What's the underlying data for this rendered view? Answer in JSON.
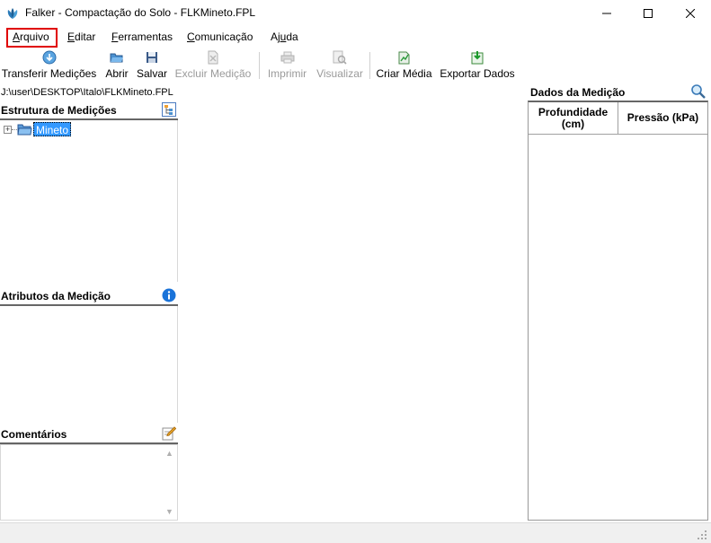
{
  "window": {
    "title": "Falker - Compactação do Solo - FLKMineto.FPL",
    "icon": "falker-app-icon"
  },
  "menu": {
    "items": [
      {
        "id": "arquivo",
        "label": "Arquivo"
      },
      {
        "id": "editar",
        "label": "Editar"
      },
      {
        "id": "ferramentas",
        "label": "Ferramentas"
      },
      {
        "id": "comunicacao",
        "label": "Comunicação"
      },
      {
        "id": "ajuda",
        "label": "Ajuda"
      }
    ],
    "highlighted": "Arquivo",
    "highlight_color": "#e00000"
  },
  "toolbar": {
    "buttons": [
      {
        "label": "Transferir Medições",
        "icon": "transfer-icon",
        "enabled": true
      },
      {
        "label": "Abrir",
        "icon": "open-folder-icon",
        "enabled": true
      },
      {
        "label": "Salvar",
        "icon": "save-icon",
        "enabled": true
      },
      {
        "label": "Excluir Medição",
        "icon": "delete-document-icon",
        "enabled": false
      },
      {
        "label": "Imprimir",
        "icon": "printer-icon",
        "enabled": false
      },
      {
        "label": "Visualizar",
        "icon": "preview-icon",
        "enabled": false
      },
      {
        "label": "Criar Média",
        "icon": "average-icon",
        "enabled": true
      },
      {
        "label": "Exportar Dados",
        "icon": "export-icon",
        "enabled": true
      }
    ]
  },
  "path": "J:\\user\\DESKTOP\\Italo\\FLKMineto.FPL",
  "panels": {
    "estrutura": {
      "title": "Estrutura de Medições",
      "icon": "tree-view-icon",
      "tree": [
        {
          "label": "Mineto",
          "expanded": false,
          "selected": true
        }
      ]
    },
    "atributos": {
      "title": "Atributos da Medição",
      "icon": "info-icon"
    },
    "comentarios": {
      "title": "Comentários",
      "icon": "edit-note-icon"
    }
  },
  "dados": {
    "title": "Dados da Medição",
    "icon": "magnifier-icon",
    "columns": [
      "Profundidade (cm)",
      "Pressão (kPa)"
    ],
    "rows": []
  },
  "colors": {
    "selection": "#3399ff",
    "statusbar": "#f0f0f0",
    "info_icon": "#1a73d9"
  }
}
